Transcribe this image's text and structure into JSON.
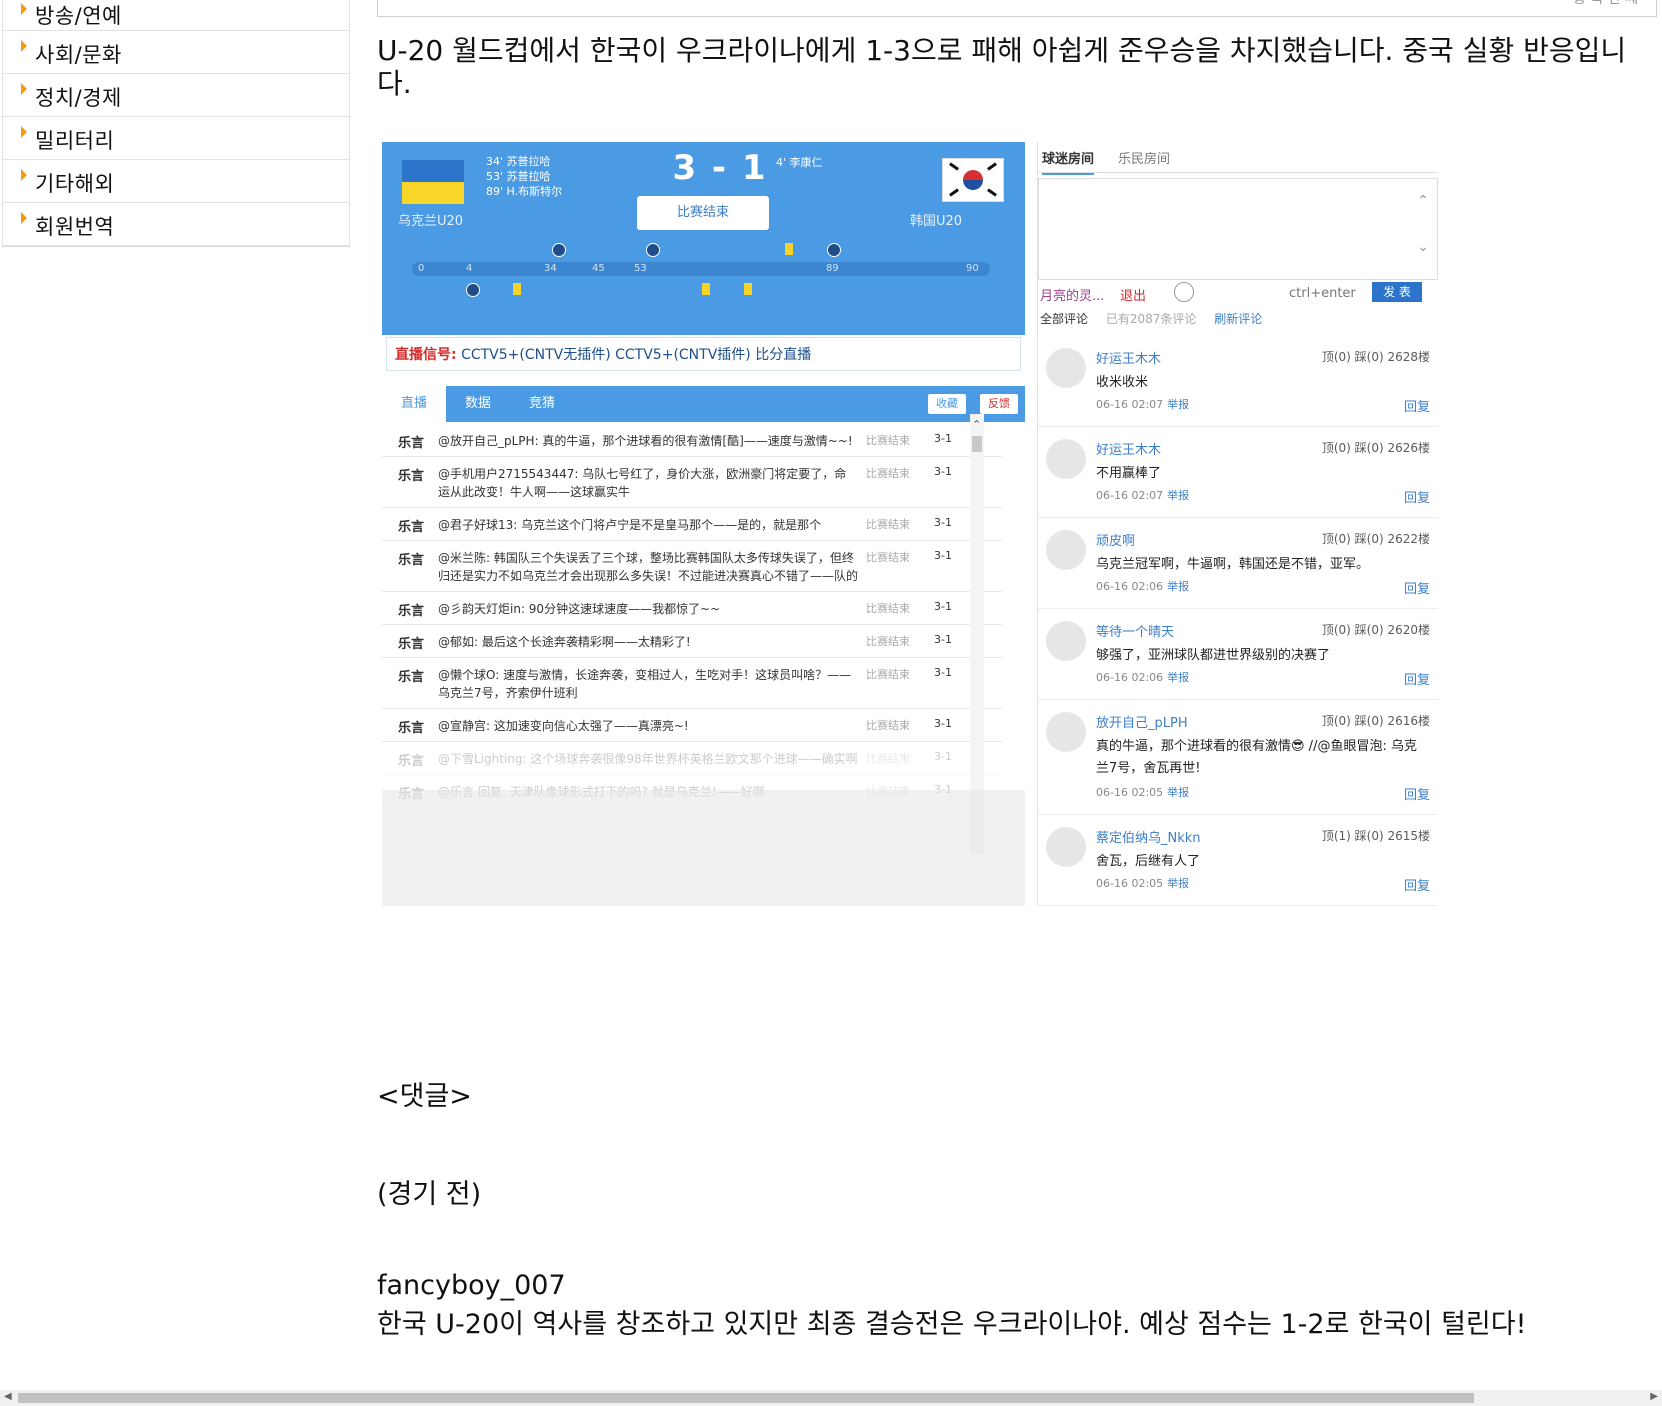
{
  "sidebar": {
    "items": [
      {
        "label": "방송/연예"
      },
      {
        "label": "사회/문화"
      },
      {
        "label": "정치/경제"
      },
      {
        "label": "밀리터리"
      },
      {
        "label": "기타해외"
      },
      {
        "label": "회원번역"
      }
    ]
  },
  "topbox": {
    "text": "종 목 번 째"
  },
  "article": {
    "lead": "U-20 월드컵에서 한국이 우크라이나에게 1-3으로 패해 아쉽게 준우승을 차지했습니다. 중국 실황 반응입니다.",
    "comments_heading": "<댓글>",
    "section_label": "(경기 전)",
    "commenter": "fancyboy_007",
    "comment": "한국 U-20이 역사를 창조하고 있지만 최종 결승전은 우크라이나야. 예상 점수는 1-2로 한국이 털린다!"
  },
  "embed": {
    "home_team": "乌克兰U20",
    "away_team": "韩国U20",
    "score": "3 - 1",
    "status": "比赛结束",
    "home_goals": [
      "34'  苏普拉哈",
      "53'  苏普拉哈",
      "89'  H.布斯特尔"
    ],
    "away_goal": "4'  李康仁",
    "timeline_ticks": [
      "0",
      "4",
      "34",
      "45",
      "53",
      "89",
      "90"
    ],
    "signal_label": "直播信号:",
    "signal_text": "CCTV5+(CNTV无插件)   CCTV5+(CNTV插件)   比分直播",
    "tabs": [
      "直播",
      "数据",
      "竞猜"
    ],
    "btn_collect": "收藏",
    "btn_feedback": "反馈",
    "feed": [
      {
        "who": "乐言",
        "msg": "@放开自己_pLPH: 真的牛逼，那个进球看的很有激情[酷]——速度与激情~~!",
        "status": "比赛结束",
        "score": "3-1"
      },
      {
        "who": "乐言",
        "msg": "@手机用户2715543447: 乌队七号红了，身价大涨，欧洲豪门将定要了，命运从此改变！牛人啊——这球赢实牛",
        "status": "比赛结束",
        "score": "3-1"
      },
      {
        "who": "乐言",
        "msg": "@君子好球13: 乌克兰这个门将卢宁是不是皇马那个——是的，就是那个",
        "status": "比赛结束",
        "score": "3-1"
      },
      {
        "who": "乐言",
        "msg": "@米兰陈: 韩国队三个失误丢了三个球，整场比赛韩国队太多传球失误了，但终归还是实力不如乌克兰才会出现那么多失误！不过能进决赛真心不错了——队的",
        "status": "比赛结束",
        "score": "3-1"
      },
      {
        "who": "乐言",
        "msg": "@彡韵天灯炬in: 90分钟这速球速度——我都惊了~~",
        "status": "比赛结束",
        "score": "3-1"
      },
      {
        "who": "乐言",
        "msg": "@郁如: 最后这个长途奔袭精彩啊——太精彩了!",
        "status": "比赛结束",
        "score": "3-1"
      },
      {
        "who": "乐言",
        "msg": "@懒个球O: 速度与激情，长途奔袭，变相过人，生吃对手！这球员叫啥？——乌克兰7号，齐索伊什班利",
        "status": "比赛结束",
        "score": "3-1"
      },
      {
        "who": "乐言",
        "msg": "@宣静宫: 这加速变向信心太强了——真漂亮~!",
        "status": "比赛结束",
        "score": "3-1"
      },
      {
        "who": "乐言",
        "msg": "@下雪Lighting: 这个场球奔袭很像98年世界杯英格兰欧文那个进球——确实啊",
        "status": "比赛结束",
        "score": "3-1"
      },
      {
        "who": "乐言",
        "msg": "@乐言 回复: 天津队像球形式打下的吗? 就是乌克兰!——好啊",
        "status": "比赛结束",
        "score": "3-1"
      }
    ],
    "comment_tabs": [
      "球迷房间",
      "乐民房间"
    ],
    "cuser": "月亮的灵...",
    "logout": "退出",
    "hint": "ctrl+enter",
    "send": "发 表",
    "filters": [
      "全部评论",
      "已有2087条评论",
      "刷新评论"
    ],
    "comments": [
      {
        "name": "好运王木木",
        "votes": "顶(0) 踩(0) 2628楼",
        "text": "收米收米",
        "time": "06-16 02:07",
        "report": "举报",
        "reply": "回复"
      },
      {
        "name": "好运王木木",
        "votes": "顶(0) 踩(0) 2626楼",
        "text": "不用赢棒了",
        "time": "06-16 02:07",
        "report": "举报",
        "reply": "回复"
      },
      {
        "name": "顽皮啊",
        "votes": "顶(0) 踩(0) 2622楼",
        "text": "乌克兰冠军啊，牛逼啊，韩国还是不错，亚军。",
        "time": "06-16 02:06",
        "report": "举报",
        "reply": "回复"
      },
      {
        "name": "等待一个晴天",
        "votes": "顶(0) 踩(0) 2620楼",
        "text": "够强了，亚洲球队都进世界级别的决赛了",
        "time": "06-16 02:06",
        "report": "举报",
        "reply": "回复"
      },
      {
        "name": "放开自己_pLPH",
        "votes": "顶(0) 踩(0) 2616楼",
        "text": "真的牛逼，那个进球看的很有激情😎 //@鱼眼冒泡: 乌克兰7号，舍瓦再世!",
        "time": "06-16 02:05",
        "report": "举报",
        "reply": "回复"
      },
      {
        "name": "蔡定伯纳乌_Nkkn",
        "votes": "顶(1) 踩(0) 2615楼",
        "text": "舍瓦，后继有人了",
        "time": "06-16 02:05",
        "report": "举报",
        "reply": "回复"
      }
    ]
  }
}
